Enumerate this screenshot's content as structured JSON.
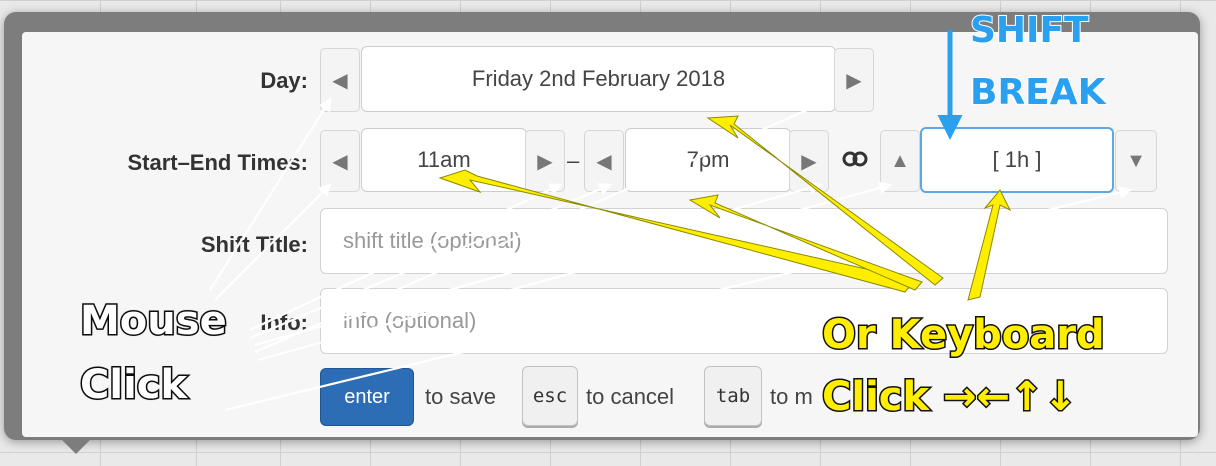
{
  "form": {
    "day_label": "Day:",
    "day_value": "Friday 2nd February 2018",
    "times_label": "Start–End Times:",
    "start_time": "11am",
    "time_separator": "–",
    "end_time": "7pm",
    "break_value": "[ 1h ]",
    "title_label": "Shift Title:",
    "title_placeholder": "shift title (optional)",
    "info_label": "Info:",
    "info_placeholder": "info (optional)"
  },
  "keys": {
    "enter_label": "enter",
    "save_text": "to save",
    "esc_label": "esc",
    "cancel_text": "to cancel",
    "tab_label": "tab",
    "move_text": "to m"
  },
  "icons": {
    "prev": "◀",
    "next": "▶",
    "up": "▲",
    "down": "▼",
    "link": "link-icon"
  },
  "annotations": {
    "shift_break_line1": "SHIFT",
    "shift_break_line2": "BREAK",
    "mouse_line1": "Mouse",
    "mouse_line2": "Click",
    "keyboard_line1": "Or Keyboard",
    "keyboard_line2": "Click →←↑↓"
  },
  "colors": {
    "enter_button": "#2d6db5",
    "focus_border": "#5ea7e6",
    "annotation_yellow": "#ffee00",
    "annotation_blue": "#2aa1f0",
    "popover_frame": "#7d7d7d"
  }
}
